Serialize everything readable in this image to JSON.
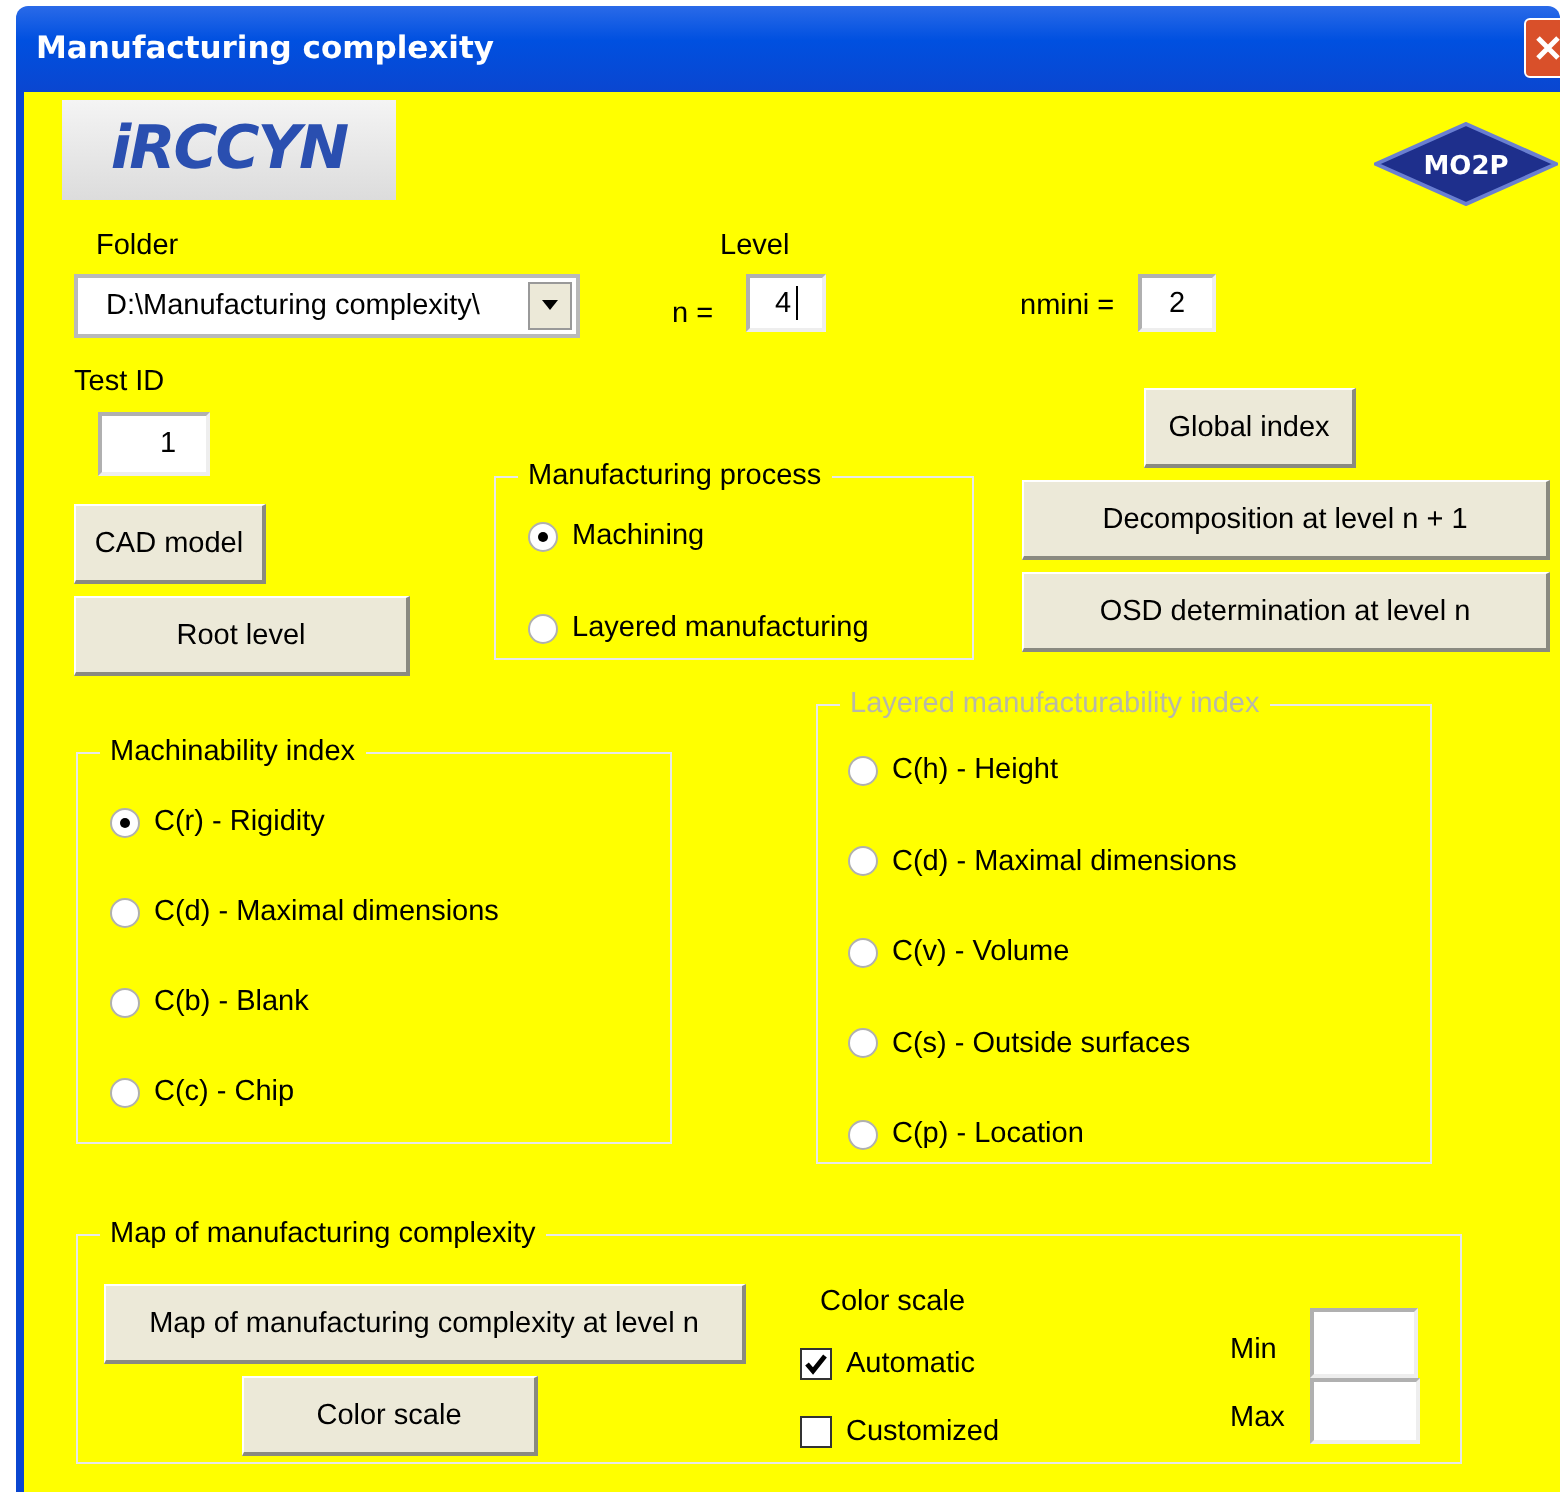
{
  "window": {
    "title": "Manufacturing complexity"
  },
  "logos": [
    {
      "text": "iRCCYN"
    },
    {
      "text": "MO2P"
    }
  ],
  "folder": {
    "label": "Folder",
    "value": "D:\\Manufacturing complexity\\"
  },
  "level": {
    "label": "Level",
    "prefix": "n =",
    "value": "4"
  },
  "nmini": {
    "label": "nmini =",
    "value": "2"
  },
  "test_id": {
    "label": "Test ID",
    "value": "1"
  },
  "buttons": [
    "CAD model",
    "Root level",
    "Global index",
    "Decomposition at level n + 1",
    "OSD determination at level n"
  ],
  "manufacturing_process": {
    "title": "Manufacturing process",
    "disabled": false,
    "options": [
      {
        "label": "Machining",
        "selected": true
      },
      {
        "label": "Layered manufacturing",
        "selected": false
      }
    ]
  },
  "machinability_index": {
    "title": "Machinability index",
    "disabled": false,
    "options": [
      {
        "label": "C(r) - Rigidity",
        "selected": true
      },
      {
        "label": "C(d) - Maximal dimensions",
        "selected": false
      },
      {
        "label": "C(b) - Blank",
        "selected": false
      },
      {
        "label": "C(c) - Chip",
        "selected": false
      }
    ]
  },
  "layered_index": {
    "title": "Layered manufacturability index",
    "disabled": true,
    "options": [
      {
        "label": "C(h) - Height",
        "selected": false
      },
      {
        "label": "C(d) - Maximal dimensions",
        "selected": false
      },
      {
        "label": "C(v) - Volume",
        "selected": false
      },
      {
        "label": "C(s) - Outside surfaces",
        "selected": false
      },
      {
        "label": "C(p) - Location",
        "selected": false
      }
    ]
  },
  "map": {
    "title": "Map of manufacturing complexity",
    "buttons": [
      "Map of manufacturing complexity at level n",
      "Color scale"
    ],
    "color_scale": {
      "label": "Color scale",
      "options": [
        {
          "label": "Automatic",
          "checked": true
        },
        {
          "label": "Customized",
          "checked": false
        }
      ]
    },
    "min": {
      "label": "Min"
    },
    "max": {
      "label": "Max"
    }
  }
}
